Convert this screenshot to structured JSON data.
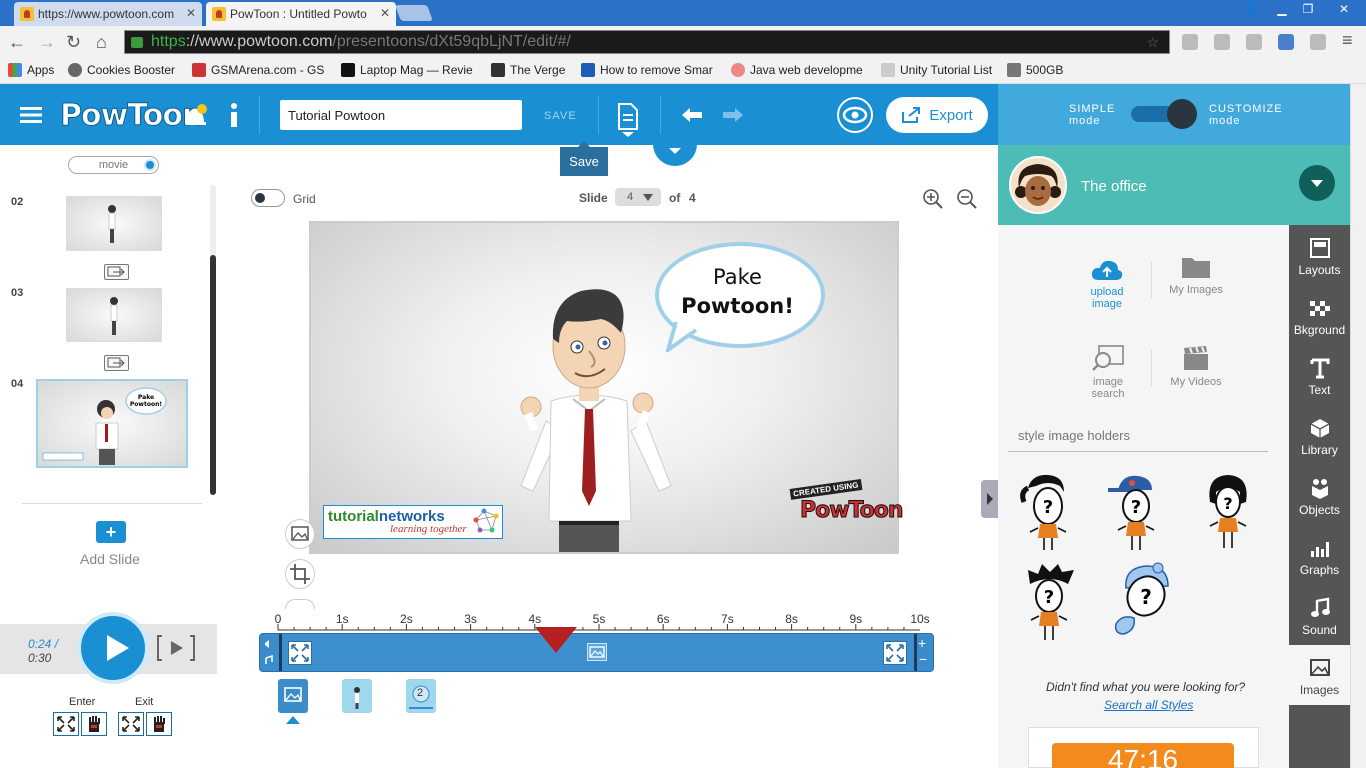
{
  "browser": {
    "tabs": [
      {
        "label": "https://www.powtoon.com"
      },
      {
        "label": "PowToon : Untitled Powto"
      }
    ],
    "url_scheme": "https",
    "url_host": "://www.powtoon.com",
    "url_path": "/presentoons/dXt59qbLjNT/edit/#/",
    "bookmarks": [
      "Apps",
      "Cookies Booster",
      "GSMArena.com - GS",
      "Laptop Mag — Revie",
      "The Verge",
      "How to remove Smar",
      "Java web developme",
      "Unity Tutorial List",
      "500GB"
    ]
  },
  "app": {
    "logo": "PowToon",
    "title_value": "Tutorial Powtoon",
    "save_label": "SAVE",
    "save_tooltip": "Save",
    "export_label": "Export",
    "simple_mode": "SIMPLE",
    "customize_mode": "CUSTOMIZE",
    "mode_word": "mode",
    "accent": "#1a8fd4"
  },
  "left": {
    "movie_toggle": "movie",
    "slides": [
      {
        "num": "02"
      },
      {
        "num": "03"
      },
      {
        "num": "04"
      }
    ],
    "add_slide_label": "Add Slide",
    "time_current": "0:24 /",
    "time_total": "0:30",
    "enter_label": "Enter",
    "exit_label": "Exit"
  },
  "canvas": {
    "grid_label": "Grid",
    "slide_label": "Slide",
    "slide_current": "4",
    "of_label": "of",
    "slide_total": "4",
    "bubble_line1": "Pake",
    "bubble_line2": "Powtoon!",
    "logo_name_a": "tutorial",
    "logo_name_b": "networks",
    "logo_tag": "learning together",
    "created_using": "CREATED USING",
    "powtoon_mark": "PowToon"
  },
  "timeline": {
    "ticks": [
      "0",
      "1s",
      "2s",
      "3s",
      "4s",
      "5s",
      "6s",
      "7s",
      "8s",
      "9s",
      "10s"
    ],
    "playhead_seconds": 4,
    "duration_seconds": 10,
    "object_badge": "2"
  },
  "right": {
    "character_name": "The office",
    "sidebar": [
      "Layouts",
      "Bkground",
      "Text",
      "Library",
      "Objects",
      "Graphs",
      "Sound",
      "Images"
    ],
    "upload_image": "upload image",
    "my_images": "My Images",
    "image_search": "image search",
    "my_videos": "My Videos",
    "style_label": "style image holders",
    "not_found": "Didn't find what you were looking for?",
    "search_all": "Search all Styles",
    "timer": "47:16"
  }
}
